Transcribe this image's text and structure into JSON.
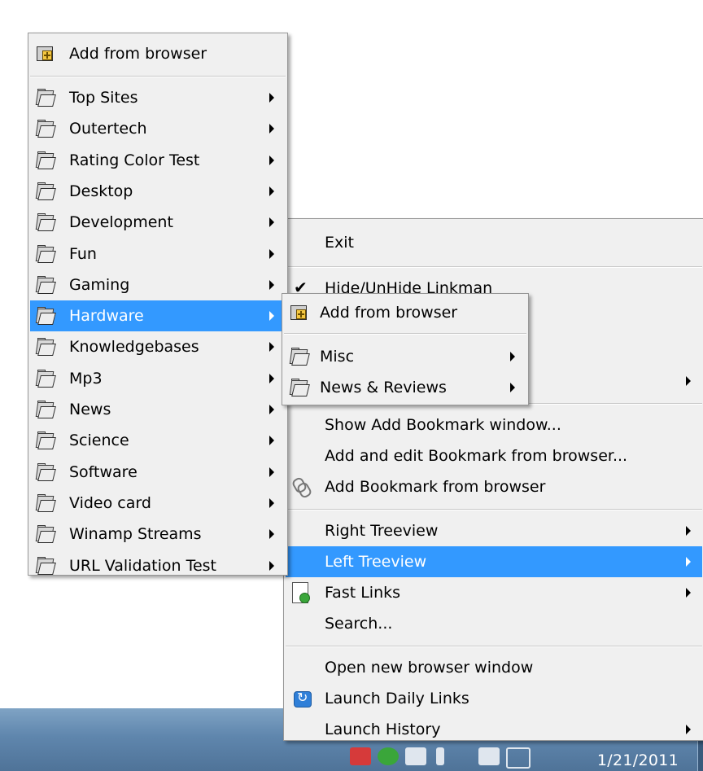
{
  "taskbar": {
    "clock_date": "1/21/2011"
  },
  "menu_bookmarks": {
    "add_from_browser": "Add from browser",
    "folders": [
      {
        "label": "Top Sites"
      },
      {
        "label": "Outertech"
      },
      {
        "label": "Rating Color Test"
      },
      {
        "label": "Desktop"
      },
      {
        "label": "Development"
      },
      {
        "label": "Fun"
      },
      {
        "label": "Gaming"
      },
      {
        "label": "Hardware"
      },
      {
        "label": "Knowledgebases"
      },
      {
        "label": "Mp3"
      },
      {
        "label": "News"
      },
      {
        "label": "Science"
      },
      {
        "label": "Software"
      },
      {
        "label": "Video card"
      },
      {
        "label": "Winamp Streams"
      },
      {
        "label": "URL Validation Test"
      }
    ],
    "highlighted": "Hardware"
  },
  "menu_hardware": {
    "add_from_browser": "Add from browser",
    "folders": [
      {
        "label": "Misc"
      },
      {
        "label": "News & Reviews"
      }
    ]
  },
  "menu_tray": {
    "exit": "Exit",
    "hide_unhide": "Hide/UnHide Linkman",
    "show_add_bookmark": "Show Add Bookmark window...",
    "add_and_edit": "Add and edit Bookmark from browser...",
    "add_bookmark": "Add Bookmark from browser",
    "right_treeview": "Right Treeview",
    "left_treeview": "Left Treeview",
    "fast_links": "Fast Links",
    "search": "Search...",
    "open_new_browser": "Open new browser window",
    "launch_daily": "Launch Daily Links",
    "launch_history": "Launch History",
    "highlighted": "Left Treeview"
  },
  "colors": {
    "highlight": "#3399ff",
    "menu_bg": "#f0f0f0"
  }
}
